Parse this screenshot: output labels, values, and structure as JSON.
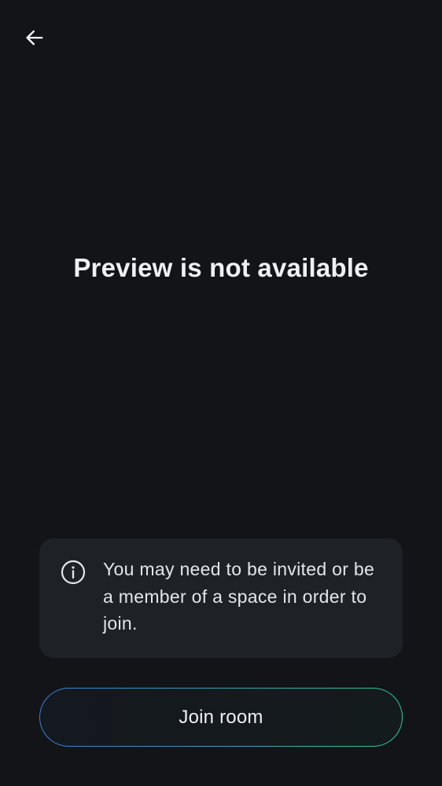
{
  "header": {
    "back_icon": "arrow-left-icon"
  },
  "main": {
    "title": "Preview is not available"
  },
  "info_card": {
    "icon": "info-icon",
    "message": "You may need to be invited or be a member of a space in order to join."
  },
  "actions": {
    "join_label": "Join room"
  },
  "colors": {
    "background": "#121418",
    "card_background": "#1e2126",
    "gradient_start": "#3a7fd6",
    "gradient_end": "#2fc59a"
  }
}
